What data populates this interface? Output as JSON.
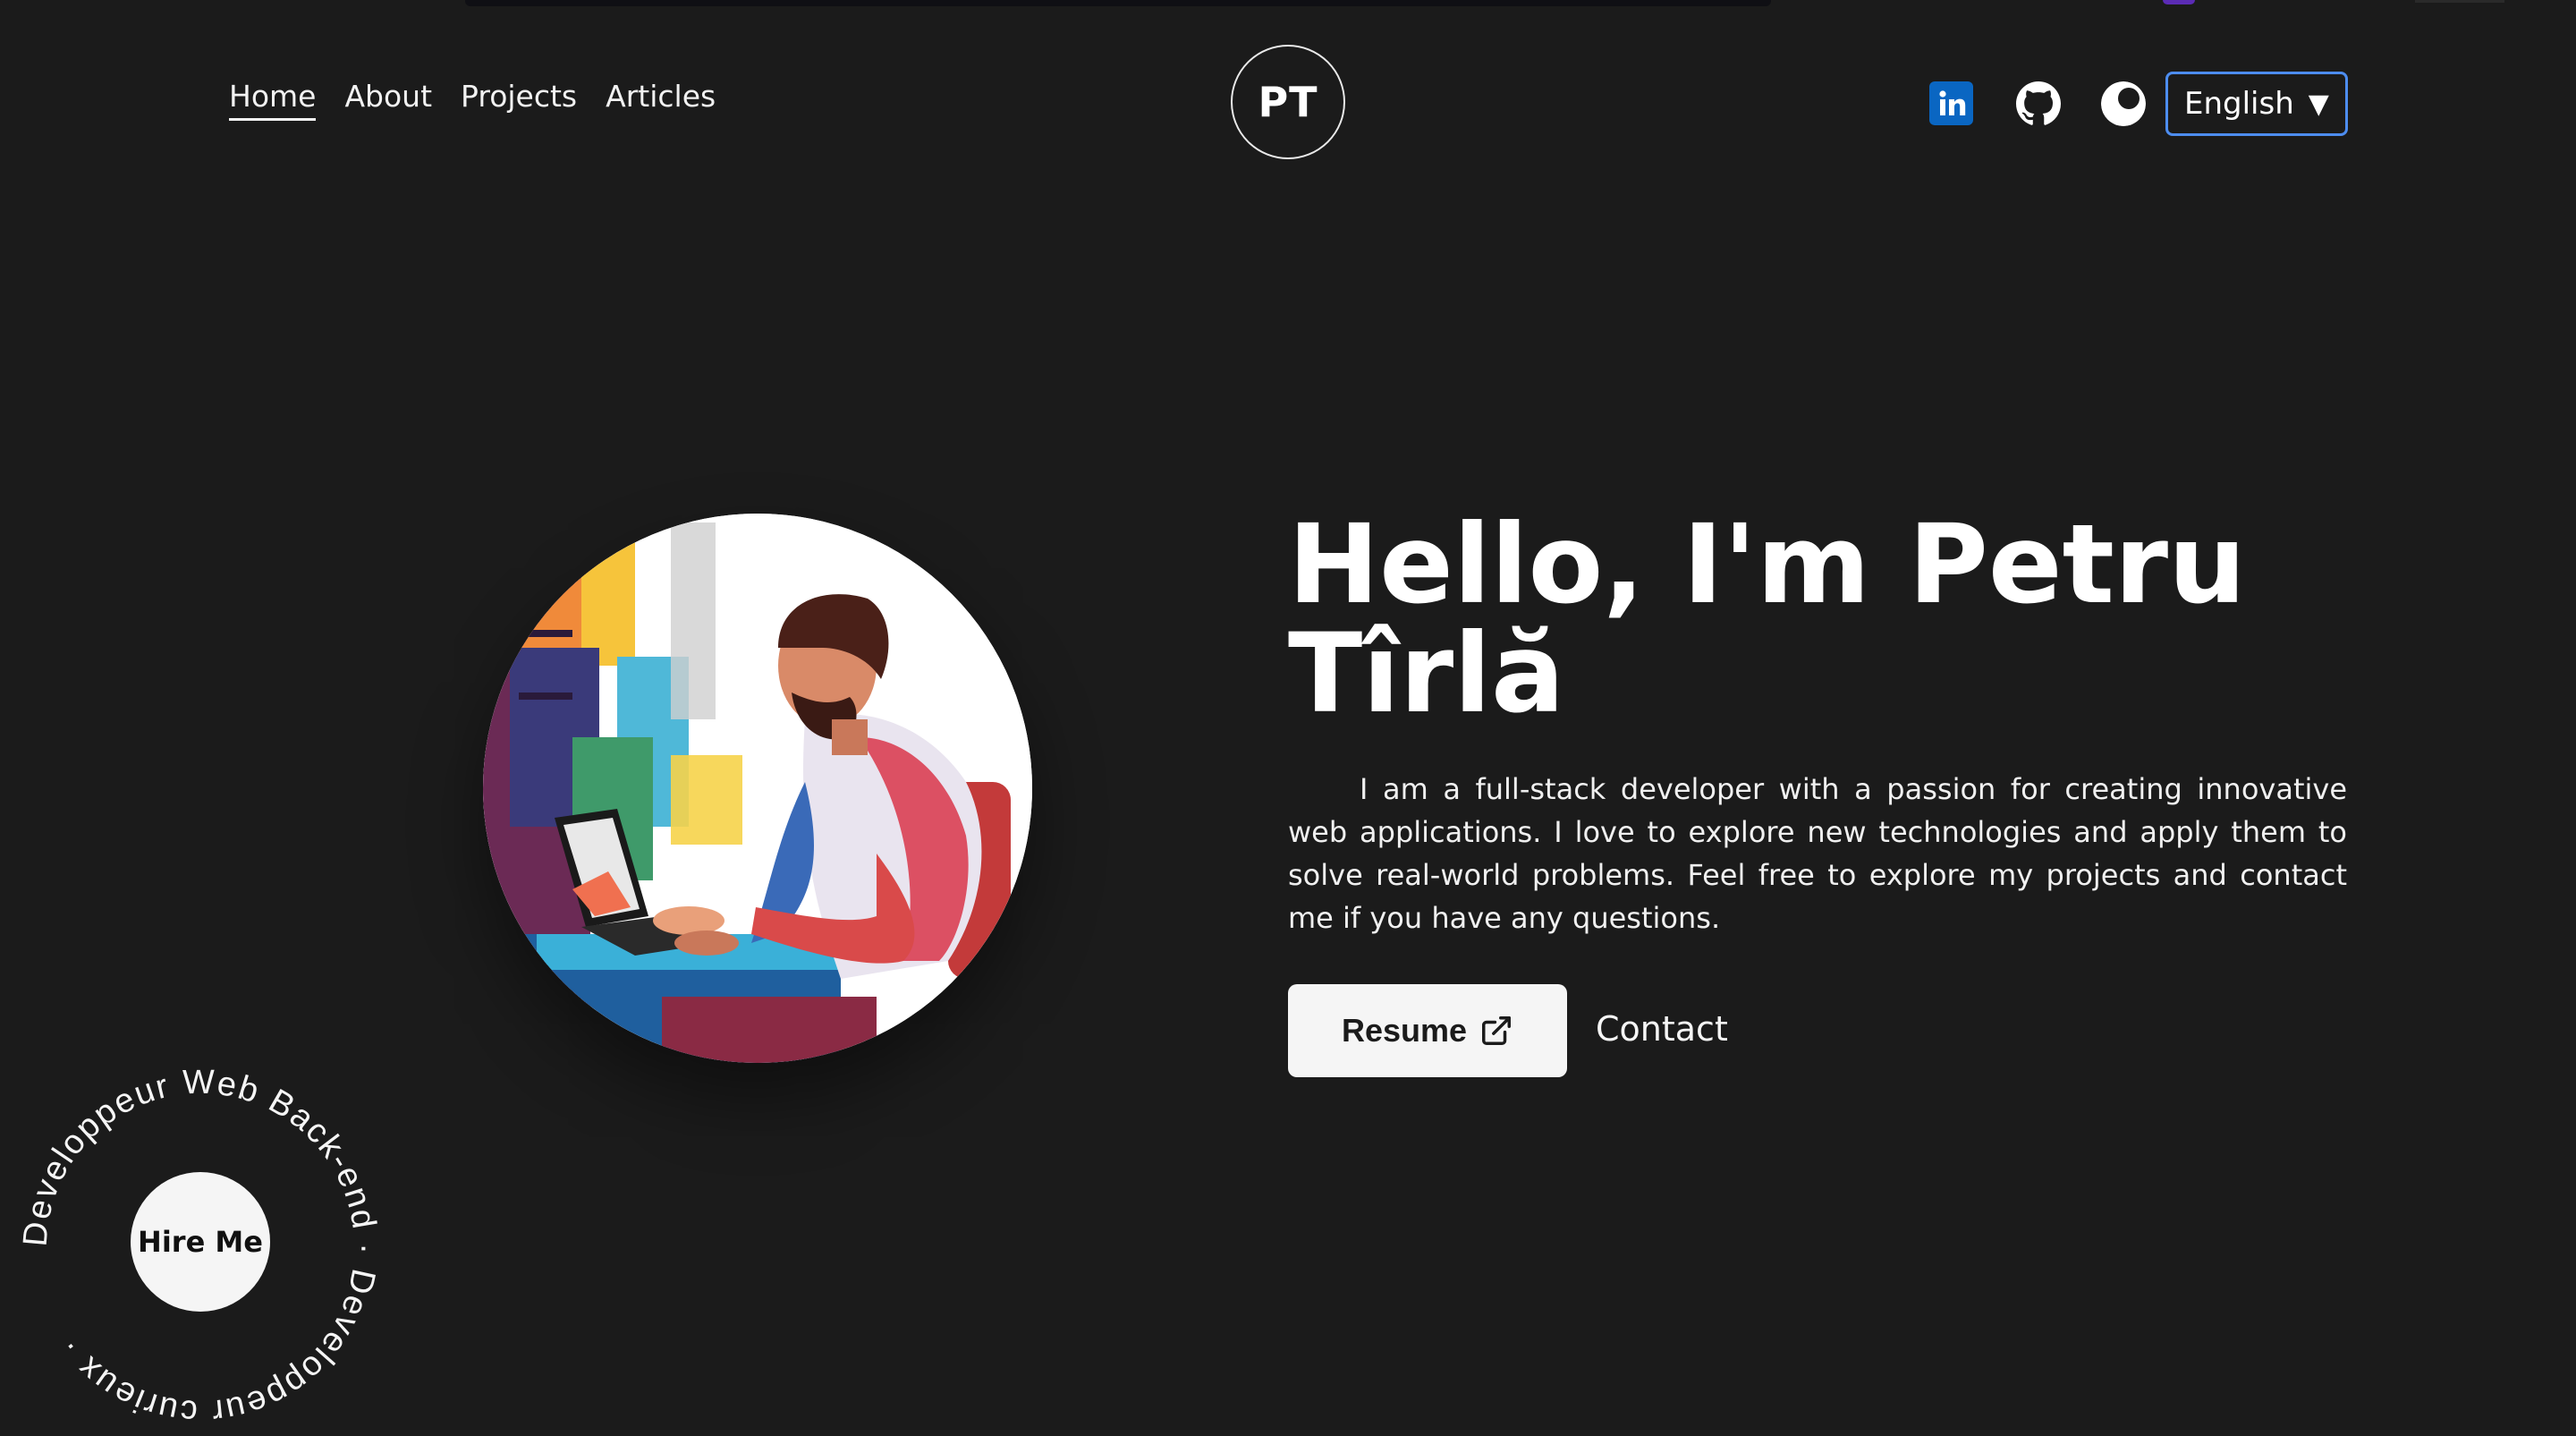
{
  "nav": {
    "items": [
      {
        "label": "Home",
        "active": true
      },
      {
        "label": "About",
        "active": false
      },
      {
        "label": "Projects",
        "active": false
      },
      {
        "label": "Articles",
        "active": false
      }
    ],
    "logo_text": "PT",
    "social": {
      "linkedin_icon": "linkedin-icon",
      "github_icon": "github-icon",
      "theme_icon": "moon-icon"
    },
    "language": {
      "selected": "English",
      "caret": "▼"
    }
  },
  "hero": {
    "title_line1": "Hello, I'm Petru",
    "title_line2": "Tîrlă",
    "description": "I am a full-stack developer with a passion for creating innovative web applications. I love to explore new technologies and apply them to solve real-world problems. Feel free to explore my projects and contact me if you have any questions.",
    "resume_label": "Resume",
    "resume_icon": "external-link-icon",
    "contact_label": "Contact"
  },
  "hire": {
    "button_label": "Hire Me",
    "ring_text": "Developpeur Web Back-end · Developpeur curieux · "
  },
  "colors": {
    "background": "#1b1b1b",
    "text": "#f5f5f5",
    "linkedin": "#0a66c2",
    "select_border": "#4d8df0"
  }
}
